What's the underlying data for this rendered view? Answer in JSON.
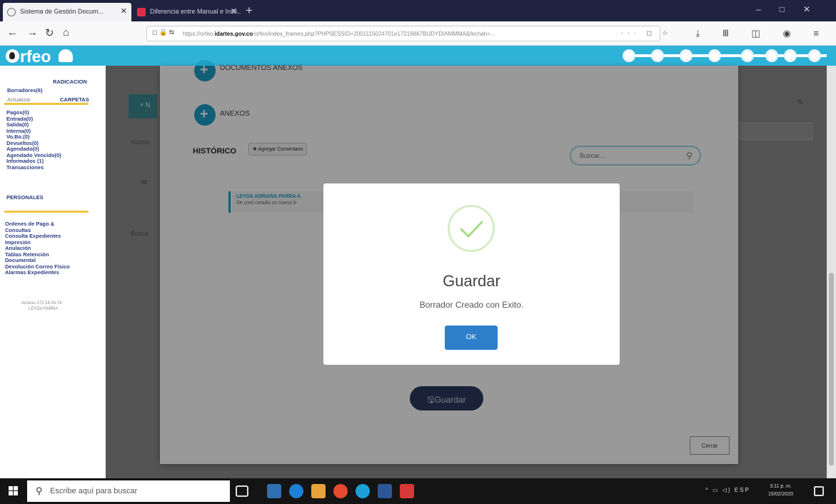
{
  "browser": {
    "tabs": [
      {
        "title": "Sistema de Gestión Docum..."
      },
      {
        "title": "Diferencia entre Manual e Insti..."
      }
    ],
    "url_prefix": "https://orfeo.",
    "url_domain": "idartes.gov.co",
    "url_path": "/orfeo/index_frames.php?PHPSESSID=2001115024701e17216867BUDYDIAMMMA&fechah=..."
  },
  "app": {
    "logo_text": "rfeo",
    "header_icon_count": 9
  },
  "sidebar": {
    "radicacion": "RADICACION",
    "borradores": "Borradores(6)",
    "actualizar": "Actualizar",
    "carpetas": "CARPETAS",
    "folders": [
      "Pagos(0)",
      "Entrada(0)",
      "Salida(0)",
      "Interna(0)",
      "Vo.Bo.(0)",
      "Devueltos(0)",
      "Agendado(0)",
      "Agendado Vencido(0)",
      "Informados (1)",
      "Transacciones"
    ],
    "personales": "PERSONALES",
    "menu": [
      "Ordenes de Pago &",
      "Consultas",
      "Consulta Expedientes",
      "Impresión",
      "Anulación",
      "Tablas Retención",
      "Documental",
      "Devolución Correo Físico",
      "Alarmas Expedientes"
    ],
    "footer": [
      "Acceso 172.16.04.74",
      "LEYDA PARRA"
    ]
  },
  "background": {
    "partial_label_1": "+ N",
    "partial_label_2": "Numer",
    "partial_label_3": "Id",
    "partial_label_4": "Busca"
  },
  "modal": {
    "section1": "DOCUMENTOS ANEXOS",
    "section2": "ANEXOS",
    "historico": "HISTÓRICO",
    "agregar_comentario": "Agregar Comentario",
    "search_placeholder": "Buscar...",
    "history_entry_title": "LEYDA ADRIANA PARRA A",
    "history_entry_text": "Se creó creado un nuevo b",
    "guardar": "Guardar",
    "cerrar": "Cerrar"
  },
  "alert": {
    "title": "Guardar",
    "message": "Borrador Creado con Exito.",
    "ok": "OK"
  },
  "taskbar": {
    "search_placeholder": "Escribe aquí para buscar",
    "tray_language": "ESP",
    "time": "3:11 p. m.",
    "date": "15/02/2020"
  },
  "colors": {
    "header_bg": "#2eb3d8",
    "accent_blue": "#1c9ec7",
    "ok_button": "#2d7fc9",
    "sidebar_line": "#efc442",
    "guardar_button": "#2c3a5c",
    "success_check": "#a5dc86"
  }
}
